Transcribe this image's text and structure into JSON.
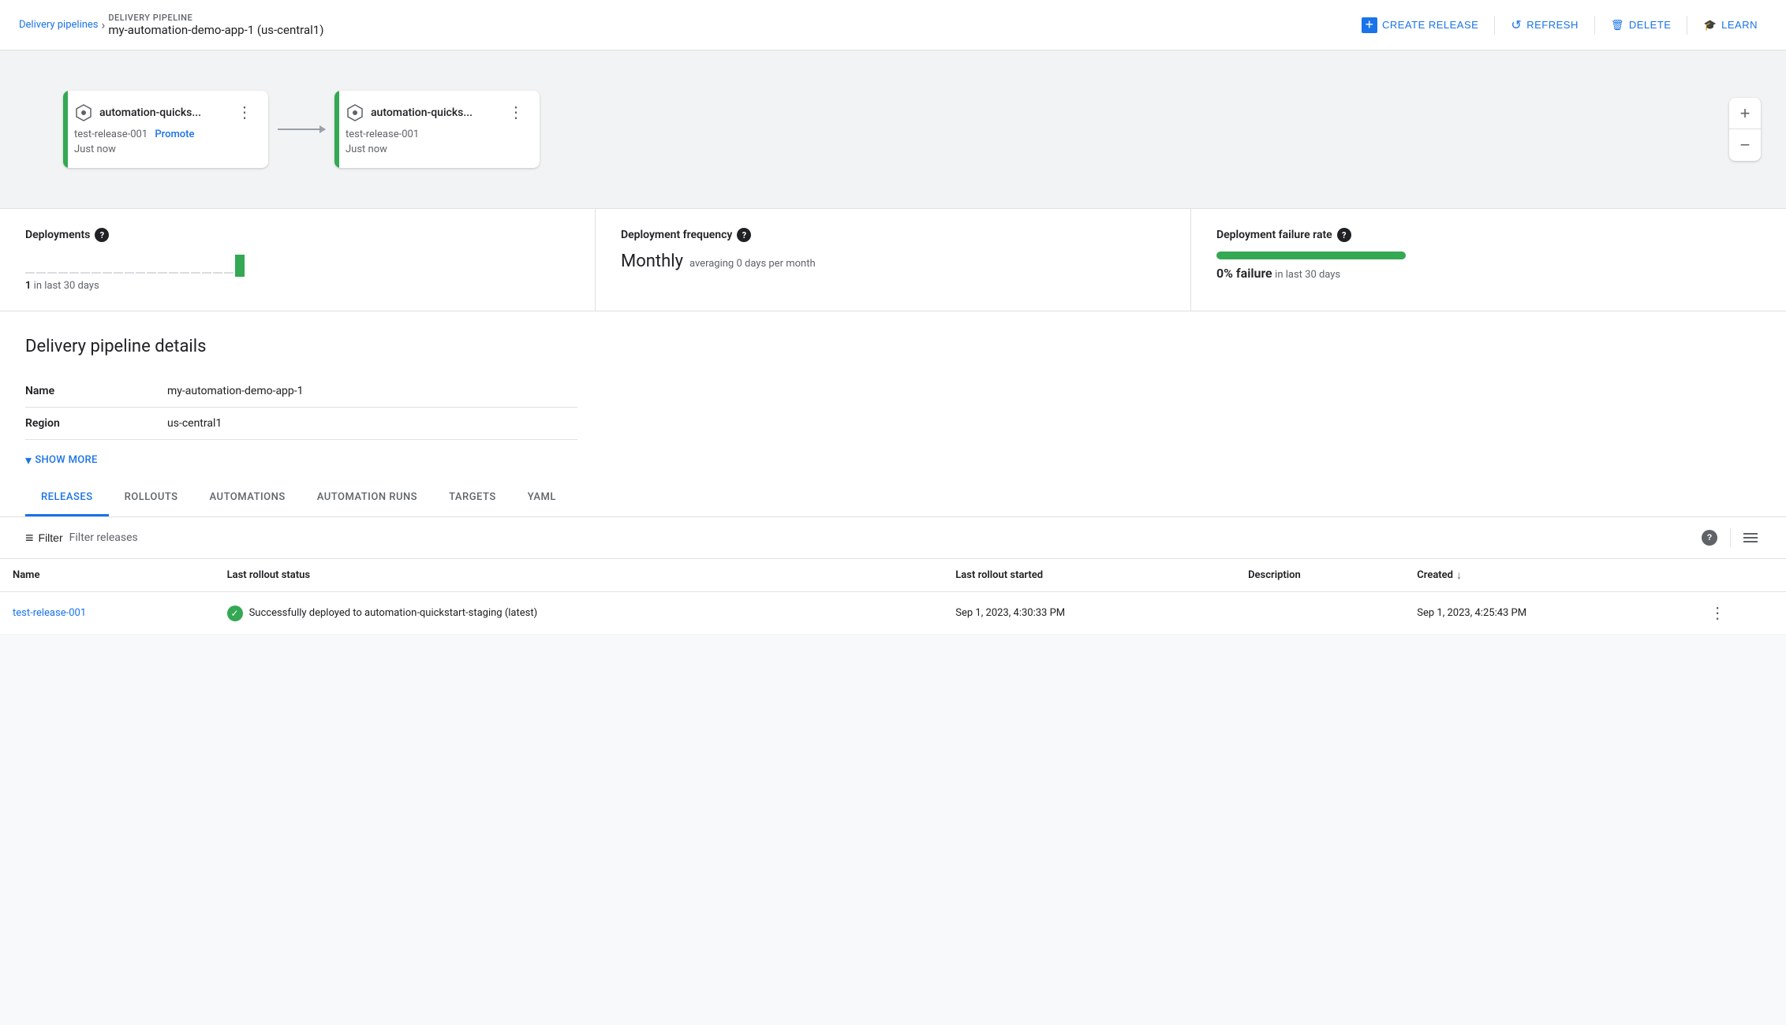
{
  "topbar": {
    "breadcrumb_link": "Delivery pipelines",
    "breadcrumb_separator": "›",
    "pipeline_label": "DELIVERY PIPELINE",
    "pipeline_name": "my-automation-demo-app-1 (us-central1)",
    "create_release_label": "CREATE RELEASE",
    "refresh_label": "REFRESH",
    "delete_label": "DELETE",
    "learn_label": "LEARN"
  },
  "pipeline": {
    "stages": [
      {
        "name": "automation-quicks...",
        "release": "test-release-001",
        "promote_label": "Promote",
        "time": "Just now"
      },
      {
        "name": "automation-quicks...",
        "release": "test-release-001",
        "promote_label": null,
        "time": "Just now"
      }
    ]
  },
  "metrics": {
    "deployments": {
      "title": "Deployments",
      "count": "1",
      "suffix": "in last 30 days"
    },
    "frequency": {
      "title": "Deployment frequency",
      "value": "Monthly",
      "sub": "averaging 0 days per month"
    },
    "failure_rate": {
      "title": "Deployment failure rate",
      "value": "0% failure",
      "sub": "in last 30 days"
    }
  },
  "details": {
    "section_title": "Delivery pipeline details",
    "rows": [
      {
        "label": "Name",
        "value": "my-automation-demo-app-1"
      },
      {
        "label": "Region",
        "value": "us-central1"
      }
    ],
    "show_more_label": "SHOW MORE"
  },
  "tabs": [
    {
      "id": "releases",
      "label": "RELEASES",
      "active": true
    },
    {
      "id": "rollouts",
      "label": "ROLLOUTS",
      "active": false
    },
    {
      "id": "automations",
      "label": "AUTOMATIONS",
      "active": false
    },
    {
      "id": "automation-runs",
      "label": "AUTOMATION RUNS",
      "active": false
    },
    {
      "id": "targets",
      "label": "TARGETS",
      "active": false
    },
    {
      "id": "yaml",
      "label": "YAML",
      "active": false
    }
  ],
  "filter": {
    "filter_label": "Filter",
    "filter_placeholder": "Filter releases"
  },
  "table": {
    "columns": [
      {
        "id": "name",
        "label": "Name",
        "sortable": false
      },
      {
        "id": "last_rollout_status",
        "label": "Last rollout status",
        "sortable": false
      },
      {
        "id": "last_rollout_started",
        "label": "Last rollout started",
        "sortable": false
      },
      {
        "id": "description",
        "label": "Description",
        "sortable": false
      },
      {
        "id": "created",
        "label": "Created",
        "sortable": true
      }
    ],
    "rows": [
      {
        "name": "test-release-001",
        "last_rollout_status": "Successfully deployed to automation-quickstart-staging (latest)",
        "last_rollout_started": "Sep 1, 2023, 4:30:33 PM",
        "description": "",
        "created": "Sep 1, 2023, 4:25:43 PM"
      }
    ]
  },
  "icons": {
    "plus": "+",
    "refresh": "↺",
    "delete": "🗑",
    "learn": "🎓",
    "help": "?",
    "chevron_down": "▾",
    "filter": "≡",
    "sort_down": "↓",
    "three_dots": "⋮",
    "check": "✓"
  }
}
